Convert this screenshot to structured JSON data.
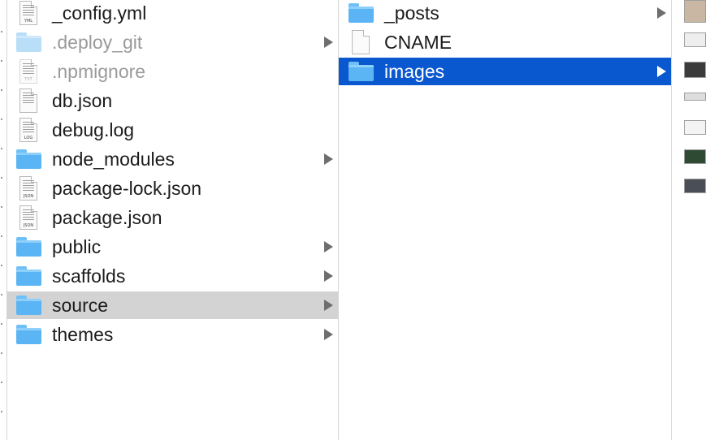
{
  "column1": {
    "items": [
      {
        "label": "_config.yml",
        "kind": "file",
        "tag": "YML",
        "dim": false,
        "arrow": false,
        "state": ""
      },
      {
        "label": ".deploy_git",
        "kind": "folder",
        "dim": true,
        "arrow": true,
        "state": ""
      },
      {
        "label": ".npmignore",
        "kind": "file",
        "tag": "TXT",
        "dim": true,
        "arrow": false,
        "state": ""
      },
      {
        "label": "db.json",
        "kind": "file",
        "tag": "",
        "dim": false,
        "arrow": false,
        "state": ""
      },
      {
        "label": "debug.log",
        "kind": "file",
        "tag": "LOG",
        "dim": false,
        "arrow": false,
        "state": ""
      },
      {
        "label": "node_modules",
        "kind": "folder",
        "dim": false,
        "arrow": true,
        "state": ""
      },
      {
        "label": "package-lock.json",
        "kind": "file",
        "tag": "JSON",
        "dim": false,
        "arrow": false,
        "state": ""
      },
      {
        "label": "package.json",
        "kind": "file",
        "tag": "JSON",
        "dim": false,
        "arrow": false,
        "state": ""
      },
      {
        "label": "public",
        "kind": "folder",
        "dim": false,
        "arrow": true,
        "state": ""
      },
      {
        "label": "scaffolds",
        "kind": "folder",
        "dim": false,
        "arrow": true,
        "state": ""
      },
      {
        "label": "source",
        "kind": "folder",
        "dim": false,
        "arrow": true,
        "state": "selected-inactive"
      },
      {
        "label": "themes",
        "kind": "folder",
        "dim": false,
        "arrow": true,
        "state": ""
      }
    ]
  },
  "column2": {
    "items": [
      {
        "label": "_posts",
        "kind": "folder",
        "dim": false,
        "arrow": true,
        "state": ""
      },
      {
        "label": "CNAME",
        "kind": "file",
        "tag": "",
        "dim": false,
        "arrow": false,
        "state": ""
      },
      {
        "label": "images",
        "kind": "folder",
        "dim": false,
        "arrow": true,
        "state": "selected-active"
      }
    ]
  },
  "column3": {
    "thumbnails": [
      {
        "icon": "image-thumbnail-icon",
        "shade": "#c9b6a3"
      },
      {
        "icon": "image-thumbnail-icon",
        "shade": "#eeeeee"
      },
      {
        "icon": "image-thumbnail-icon",
        "shade": "#3b3b3b"
      },
      {
        "icon": "image-thumbnail-icon",
        "shade": "#dddddd"
      },
      {
        "icon": "image-thumbnail-icon",
        "shade": "#f4f4f4"
      },
      {
        "icon": "image-thumbnail-icon",
        "shade": "#2f4a33"
      },
      {
        "icon": "image-thumbnail-icon",
        "shade": "#4a4f57"
      }
    ]
  },
  "colors": {
    "selection_active": "#0a58d0",
    "selection_inactive": "#d3d3d3",
    "folder_blue": "#5bb4f3"
  }
}
